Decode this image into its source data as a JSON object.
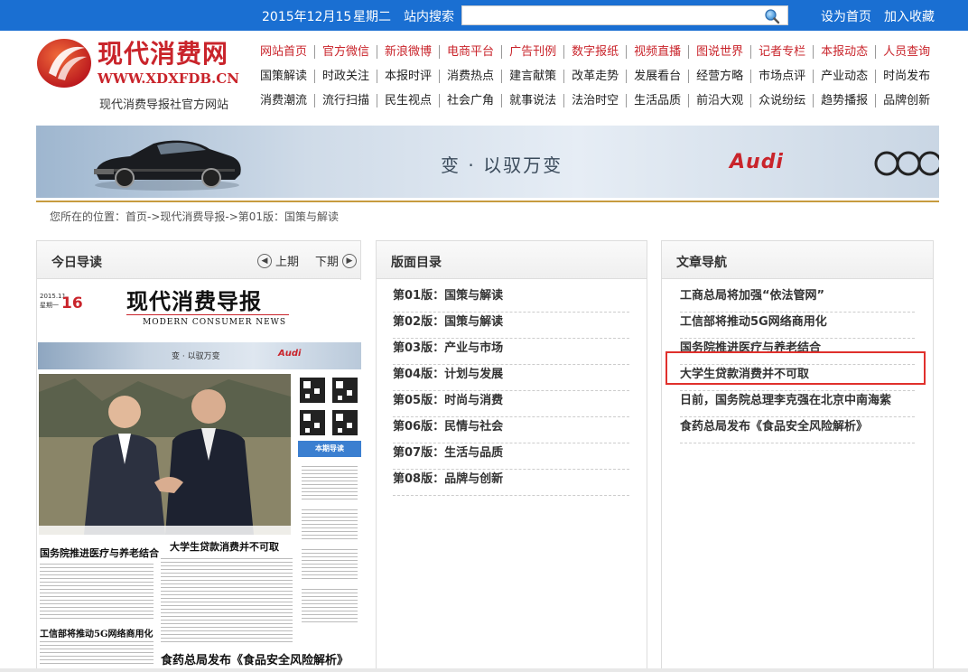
{
  "topbar": {
    "date": "2015年12月15",
    "weekday": "星期二",
    "search_label": "站内搜索",
    "search_value": "",
    "set_home": "设为首页",
    "add_favorite": "加入收藏",
    "icons": {
      "search": "magnifier-icon"
    }
  },
  "logo": {
    "cn": "现代消费网",
    "en": "WWW.XDXFDB.CN",
    "subtitle": "现代消费导报社官方网站"
  },
  "nav": {
    "row1": [
      "网站首页",
      "官方微信",
      "新浪微博",
      "电商平台",
      "广告刊例",
      "数字报纸",
      "视频直播",
      "图说世界",
      "记者专栏",
      "本报动态",
      "人员查询"
    ],
    "row2": [
      "国策解读",
      "时政关注",
      "本报时评",
      "消费热点",
      "建言献策",
      "改革走势",
      "发展看台",
      "经营方略",
      "市场点评",
      "产业动态",
      "时尚发布"
    ],
    "row3": [
      "消费潮流",
      "流行扫描",
      "民生视点",
      "社会广角",
      "就事说法",
      "法治时空",
      "生活品质",
      "前沿大观",
      "众说纷纭",
      "趋势播报",
      "品牌创新"
    ]
  },
  "banner": {
    "slogan": "变 · 以驭万变",
    "brand": "Audi"
  },
  "breadcrumb": "您所在的位置：首页->现代消费导报->第01版：国策与解读",
  "today": {
    "title": "今日导读",
    "prev": "上期",
    "next": "下期"
  },
  "paper": {
    "date": "2015.11",
    "weekday": "星期一",
    "page_no": "16",
    "title_cn": "现代消费导报",
    "title_en": "MODERN CONSUMER NEWS",
    "ad_slogan": "变 · 以驭万变",
    "ad_brand": "Audi",
    "sidebox_header": "本期导读",
    "headline1": "国务院推进医疗与养老结合",
    "headline2": "大学生贷款消费并不可取",
    "headline3": "工信部将推动5G网络商用化",
    "headline4": "食药总局发布《食品安全风险解析》"
  },
  "editions": {
    "title": "版面目录",
    "items": [
      "第01版：国策与解读",
      "第02版：国策与解读",
      "第03版：产业与市场",
      "第04版：计划与发展",
      "第05版：时尚与消费",
      "第06版：民情与社会",
      "第07版：生活与品质",
      "第08版：品牌与创新"
    ]
  },
  "articles": {
    "title": "文章导航",
    "items": [
      "工商总局将加强“依法管网”",
      "工信部将推动5G网络商用化",
      "国务院推进医疗与养老结合",
      "大学生贷款消费并不可取",
      "日前，国务院总理李克强在北京中南海紫",
      "食药总局发布《食品安全风险解析》"
    ]
  },
  "colors": {
    "topbar": "#1a6fd2",
    "brand_red": "#c9242b",
    "highlight": "#e0302c"
  }
}
